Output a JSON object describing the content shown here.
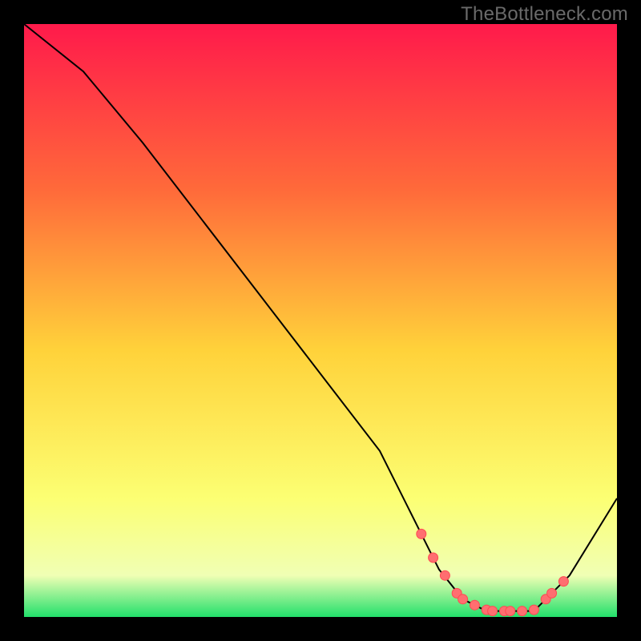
{
  "watermark": "TheBottleneck.com",
  "colors": {
    "grad_top": "#ff1a4b",
    "grad_upper": "#ff6a3a",
    "grad_mid": "#ffd23a",
    "grad_lower": "#fcff73",
    "grad_near": "#f0ffb4",
    "grad_bottom": "#22e06b",
    "line": "#000000",
    "point_fill": "#ff6e70",
    "point_stroke": "#ff4a52",
    "frame": "#000000"
  },
  "chart_data": {
    "type": "line",
    "title": "",
    "xlabel": "",
    "ylabel": "",
    "xlim": [
      0,
      100
    ],
    "ylim": [
      0,
      100
    ],
    "series": [
      {
        "name": "curve",
        "x": [
          0,
          10,
          20,
          30,
          40,
          50,
          60,
          67,
          70,
          74,
          78,
          82,
          86,
          88,
          92,
          100
        ],
        "y": [
          100,
          92,
          80,
          67,
          54,
          41,
          28,
          14,
          8,
          3,
          1,
          1,
          1,
          3,
          7,
          20
        ]
      }
    ],
    "points": {
      "name": "optimal-region-markers",
      "x": [
        67,
        69,
        71,
        73,
        74,
        76,
        78,
        79,
        81,
        82,
        84,
        86,
        88,
        89,
        91
      ],
      "y": [
        14,
        10,
        7,
        4,
        3,
        2,
        1.2,
        1.0,
        1.0,
        1.0,
        1.0,
        1.2,
        3,
        4,
        6
      ]
    }
  }
}
